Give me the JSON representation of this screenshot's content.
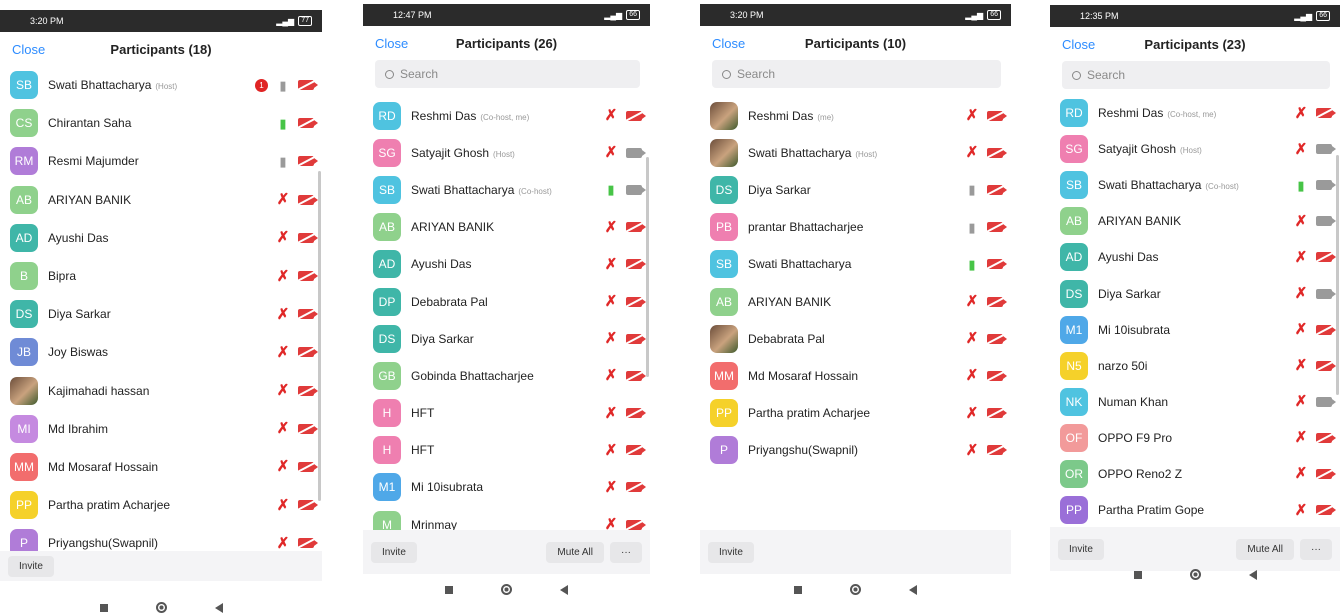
{
  "colors": {
    "accent": "#2d8cff",
    "muted_red": "#e02828",
    "live_green": "#47c447",
    "idle_gray": "#9a9a9a"
  },
  "mic_glyphs": {
    "muted": "✗",
    "live": "▮",
    "idle": "▮"
  },
  "screens": [
    {
      "status_time": "3:20 PM",
      "battery": "77",
      "close_label": "Close",
      "title": "Participants (18)",
      "search_placeholder": "",
      "participants": [
        {
          "initials": "SB",
          "name": "Swati Bhattacharya",
          "tag": "(Host)",
          "color": "#4fc3e0",
          "mic": "idle",
          "cam": "off",
          "badge": "1"
        },
        {
          "initials": "CS",
          "name": "Chirantan Saha",
          "tag": "",
          "color": "#8fd18c",
          "mic": "live",
          "cam": "off"
        },
        {
          "initials": "RM",
          "name": "Resmi Majumder",
          "tag": "",
          "color": "#b07cd8",
          "mic": "idle",
          "cam": "off"
        },
        {
          "initials": "AB",
          "name": "ARIYAN BANIK",
          "tag": "",
          "color": "#8fd18c",
          "mic": "muted",
          "cam": "off"
        },
        {
          "initials": "AD",
          "name": "Ayushi Das",
          "tag": "",
          "color": "#3fb6a8",
          "mic": "muted",
          "cam": "off"
        },
        {
          "initials": "B",
          "name": "Bipra",
          "tag": "",
          "color": "#8fd18c",
          "mic": "muted",
          "cam": "off"
        },
        {
          "initials": "DS",
          "name": "Diya Sarkar",
          "tag": "",
          "color": "#3fb6a8",
          "mic": "muted",
          "cam": "off"
        },
        {
          "initials": "JB",
          "name": "Joy Biswas",
          "tag": "",
          "color": "#6f8bd6",
          "mic": "muted",
          "cam": "off"
        },
        {
          "initials": "",
          "name": "Kajimahadi hassan",
          "tag": "",
          "color": "#7a6a5a",
          "photo": true,
          "mic": "muted",
          "cam": "off"
        },
        {
          "initials": "MI",
          "name": "Md Ibrahim",
          "tag": "",
          "color": "#c58ae0",
          "mic": "muted",
          "cam": "off"
        },
        {
          "initials": "MM",
          "name": "Md Mosaraf Hossain",
          "tag": "",
          "color": "#f26d6d",
          "mic": "muted",
          "cam": "off"
        },
        {
          "initials": "PP",
          "name": "Partha pratim Acharjee",
          "tag": "",
          "color": "#f5d12a",
          "mic": "muted",
          "cam": "off"
        },
        {
          "initials": "P",
          "name": "Priyangshu(Swapnil)",
          "tag": "",
          "color": "#b07cd8",
          "mic": "muted",
          "cam": "off"
        }
      ],
      "footer": {
        "invite": "Invite",
        "mute_all": "",
        "more": ""
      }
    },
    {
      "status_time": "12:47 PM",
      "battery": "66",
      "close_label": "Close",
      "title": "Participants (26)",
      "search_placeholder": "Search",
      "participants": [
        {
          "initials": "RD",
          "name": "Reshmi Das",
          "tag": "(Co-host, me)",
          "color": "#4fc3e0",
          "mic": "muted",
          "cam": "off"
        },
        {
          "initials": "SG",
          "name": "Satyajit Ghosh",
          "tag": "(Host)",
          "color": "#ef7fb0",
          "mic": "muted",
          "cam": "on"
        },
        {
          "initials": "SB",
          "name": "Swati Bhattacharya",
          "tag": "(Co-host)",
          "color": "#4fc3e0",
          "mic": "live",
          "cam": "on"
        },
        {
          "initials": "AB",
          "name": "ARIYAN BANIK",
          "tag": "",
          "color": "#8fd18c",
          "mic": "muted",
          "cam": "off"
        },
        {
          "initials": "AD",
          "name": "Ayushi Das",
          "tag": "",
          "color": "#3fb6a8",
          "mic": "muted",
          "cam": "off"
        },
        {
          "initials": "DP",
          "name": "Debabrata Pal",
          "tag": "",
          "color": "#3fb6a8",
          "mic": "muted",
          "cam": "off"
        },
        {
          "initials": "DS",
          "name": "Diya Sarkar",
          "tag": "",
          "color": "#3fb6a8",
          "mic": "muted",
          "cam": "off"
        },
        {
          "initials": "GB",
          "name": "Gobinda Bhattacharjee",
          "tag": "",
          "color": "#8fd18c",
          "mic": "muted",
          "cam": "off"
        },
        {
          "initials": "H",
          "name": "HFT",
          "tag": "",
          "color": "#ef7fb0",
          "mic": "muted",
          "cam": "off"
        },
        {
          "initials": "H",
          "name": "HFT",
          "tag": "",
          "color": "#ef7fb0",
          "mic": "muted",
          "cam": "off"
        },
        {
          "initials": "M1",
          "name": "Mi 10isubrata",
          "tag": "",
          "color": "#4fa8e8",
          "mic": "muted",
          "cam": "off"
        },
        {
          "initials": "M",
          "name": "Mrinmay",
          "tag": "",
          "color": "#8fd18c",
          "mic": "muted",
          "cam": "off"
        }
      ],
      "footer": {
        "invite": "Invite",
        "mute_all": "Mute All",
        "more": "···"
      }
    },
    {
      "status_time": "3:20 PM",
      "battery": "66",
      "close_label": "Close",
      "title": "Participants (10)",
      "search_placeholder": "Search",
      "participants": [
        {
          "initials": "",
          "name": "Reshmi Das",
          "tag": "(me)",
          "color": "#5a6a3a",
          "photo": true,
          "mic": "muted",
          "cam": "off"
        },
        {
          "initials": "",
          "name": "Swati Bhattacharya",
          "tag": "(Host)",
          "color": "#8a3a3a",
          "photo": true,
          "mic": "muted",
          "cam": "off"
        },
        {
          "initials": "DS",
          "name": "Diya Sarkar",
          "tag": "",
          "color": "#3fb6a8",
          "mic": "idle",
          "cam": "off"
        },
        {
          "initials": "PB",
          "name": "prantar Bhattacharjee",
          "tag": "",
          "color": "#ef7fb0",
          "mic": "idle",
          "cam": "off"
        },
        {
          "initials": "SB",
          "name": "Swati Bhattacharya",
          "tag": "",
          "color": "#4fc3e0",
          "mic": "live",
          "cam": "off"
        },
        {
          "initials": "AB",
          "name": "ARIYAN BANIK",
          "tag": "",
          "color": "#8fd18c",
          "mic": "muted",
          "cam": "off"
        },
        {
          "initials": "",
          "name": "Debabrata Pal",
          "tag": "",
          "color": "#c08a40",
          "photo": true,
          "mic": "muted",
          "cam": "off"
        },
        {
          "initials": "MM",
          "name": "Md Mosaraf Hossain",
          "tag": "",
          "color": "#f26d6d",
          "mic": "muted",
          "cam": "off"
        },
        {
          "initials": "PP",
          "name": "Partha pratim Acharjee",
          "tag": "",
          "color": "#f5d12a",
          "mic": "muted",
          "cam": "off"
        },
        {
          "initials": "P",
          "name": "Priyangshu(Swapnil)",
          "tag": "",
          "color": "#b07cd8",
          "mic": "muted",
          "cam": "off"
        }
      ],
      "footer": {
        "invite": "Invite",
        "mute_all": "",
        "more": ""
      }
    },
    {
      "status_time": "12:35 PM",
      "battery": "66",
      "close_label": "Close",
      "title": "Participants (23)",
      "search_placeholder": "Search",
      "participants": [
        {
          "initials": "RD",
          "name": "Reshmi Das",
          "tag": "(Co-host, me)",
          "color": "#4fc3e0",
          "mic": "muted",
          "cam": "off"
        },
        {
          "initials": "SG",
          "name": "Satyajit Ghosh",
          "tag": "(Host)",
          "color": "#ef7fb0",
          "mic": "muted",
          "cam": "on"
        },
        {
          "initials": "SB",
          "name": "Swati Bhattacharya",
          "tag": "(Co-host)",
          "color": "#4fc3e0",
          "mic": "live",
          "cam": "on"
        },
        {
          "initials": "AB",
          "name": "ARIYAN BANIK",
          "tag": "",
          "color": "#8fd18c",
          "mic": "muted",
          "cam": "on"
        },
        {
          "initials": "AD",
          "name": "Ayushi Das",
          "tag": "",
          "color": "#3fb6a8",
          "mic": "muted",
          "cam": "off"
        },
        {
          "initials": "DS",
          "name": "Diya Sarkar",
          "tag": "",
          "color": "#3fb6a8",
          "mic": "muted",
          "cam": "on"
        },
        {
          "initials": "M1",
          "name": "Mi 10isubrata",
          "tag": "",
          "color": "#4fa8e8",
          "mic": "muted",
          "cam": "off"
        },
        {
          "initials": "N5",
          "name": "narzo 50i",
          "tag": "",
          "color": "#f5d12a",
          "mic": "muted",
          "cam": "off"
        },
        {
          "initials": "NK",
          "name": "Numan Khan",
          "tag": "",
          "color": "#4fc3e0",
          "mic": "muted",
          "cam": "on"
        },
        {
          "initials": "OF",
          "name": "OPPO F9 Pro",
          "tag": "",
          "color": "#f29a9a",
          "mic": "muted",
          "cam": "off"
        },
        {
          "initials": "OR",
          "name": "OPPO Reno2 Z",
          "tag": "",
          "color": "#7cc98a",
          "mic": "muted",
          "cam": "off"
        },
        {
          "initials": "PP",
          "name": "Partha Pratim Gope",
          "tag": "",
          "color": "#9a6fd8",
          "mic": "muted",
          "cam": "off"
        }
      ],
      "footer": {
        "invite": "Invite",
        "mute_all": "Mute All",
        "more": "···"
      }
    }
  ]
}
